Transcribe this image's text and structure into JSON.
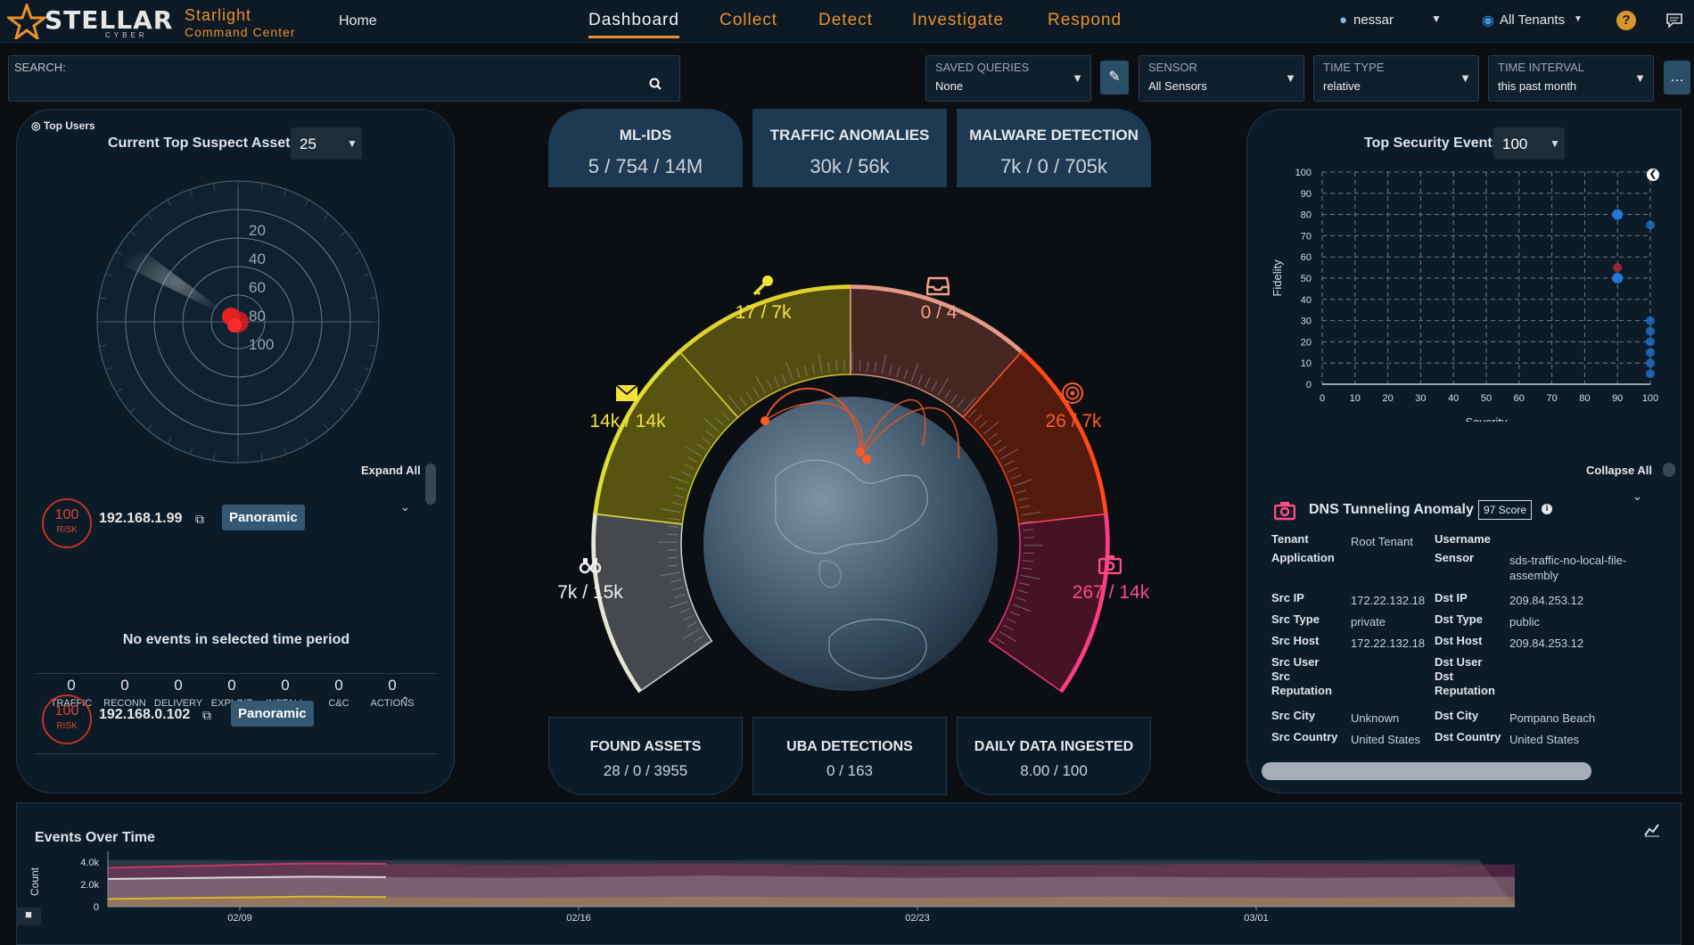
{
  "header": {
    "logo": "STELLAR",
    "logo_sub": "CYBER",
    "app_name": "Starlight",
    "app_sub": "Command Center",
    "home": "Home",
    "tabs": [
      "Dashboard",
      "Collect",
      "Detect",
      "Investigate",
      "Respond"
    ],
    "active_tab": "Dashboard",
    "user": "nessar",
    "tenant": "All Tenants"
  },
  "filters": {
    "search_label": "SEARCH:",
    "search_value": "",
    "saved_queries_label": "SAVED QUERIES",
    "saved_queries_value": "None",
    "sensor_label": "SENSOR",
    "sensor_value": "All Sensors",
    "time_type_label": "TIME TYPE",
    "time_type_value": "relative",
    "time_interval_label": "TIME INTERVAL",
    "time_interval_value": "this past month"
  },
  "left_panel": {
    "top_users": "Top Users",
    "title": "Current Top Suspect Assets",
    "count": "25",
    "radar_rings": [
      "20",
      "40",
      "60",
      "80",
      "100"
    ],
    "expand_all": "Expand All",
    "assets": [
      {
        "risk": "100",
        "risk_label": "RISK",
        "ip": "192.168.1.99",
        "button": "Panoramic"
      },
      {
        "risk": "100",
        "risk_label": "RISK",
        "ip": "192.168.0.102",
        "button": "Panoramic"
      }
    ],
    "killchain": [
      {
        "count": "0",
        "label": "TRAFFIC"
      },
      {
        "count": "0",
        "label": "RECONN"
      },
      {
        "count": "0",
        "label": "DELIVERY"
      },
      {
        "count": "0",
        "label": "EXPLOIT"
      },
      {
        "count": "0",
        "label": "INSTALL"
      },
      {
        "count": "0",
        "label": "C&C"
      },
      {
        "count": "0",
        "label": "ACTIONS"
      }
    ],
    "no_events": "No events in selected time period"
  },
  "center": {
    "top_cards": [
      {
        "title": "ML-IDS",
        "value": "5 / 754 / 14M"
      },
      {
        "title": "TRAFFIC ANOMALIES",
        "value": "30k / 56k"
      },
      {
        "title": "MALWARE DETECTION",
        "value": "7k / 0 / 705k"
      }
    ],
    "bottom_cards": [
      {
        "title": "FOUND ASSETS",
        "value": "28 / 0 / 3955"
      },
      {
        "title": "UBA DETECTIONS",
        "value": "0 / 163"
      },
      {
        "title": "DAILY DATA INGESTED",
        "value": "8.00 / 100"
      }
    ],
    "segments": [
      {
        "label": "7k / 15k",
        "icon": "binoculars-icon",
        "color": "#f0f0f0"
      },
      {
        "label": "14k / 14k",
        "icon": "envelope-icon",
        "color": "#f2e23a"
      },
      {
        "label": "17 / 7k",
        "icon": "key-icon",
        "color": "#f2e23a"
      },
      {
        "label": "0 / 4",
        "icon": "inbox-icon",
        "color": "#f3a08a"
      },
      {
        "label": "26 / 7k",
        "icon": "target-icon",
        "color": "#ff5a2a"
      },
      {
        "label": "267 / 14k",
        "icon": "camera-icon",
        "color": "#ff4d88"
      }
    ]
  },
  "right_panel": {
    "title": "Top Security Events",
    "count": "100",
    "x_label": "Severity",
    "y_label": "Fidelity",
    "collapse_all": "Collapse All",
    "event": {
      "title": "DNS Tunneling Anomaly",
      "score": "97 Score",
      "fields_left": [
        {
          "k": "Tenant",
          "v": "Root Tenant"
        },
        {
          "k": "Application",
          "v": ""
        },
        {
          "k": "Src IP",
          "v": "172.22.132.18"
        },
        {
          "k": "Src Type",
          "v": "private"
        },
        {
          "k": "Src Host",
          "v": "172.22.132.18"
        },
        {
          "k": "Src User",
          "v": ""
        },
        {
          "k": "Src Reputation",
          "v": ""
        },
        {
          "k": "Src City",
          "v": "Unknown"
        },
        {
          "k": "Src Country",
          "v": "United States"
        }
      ],
      "fields_right": [
        {
          "k": "Username",
          "v": ""
        },
        {
          "k": "Sensor",
          "v": "sds-traffic-no-local-file-assembly"
        },
        {
          "k": "Dst IP",
          "v": "209.84.253.12"
        },
        {
          "k": "Dst Type",
          "v": "public"
        },
        {
          "k": "Dst Host",
          "v": "209.84.253.12"
        },
        {
          "k": "Dst User",
          "v": ""
        },
        {
          "k": "Dst Reputation",
          "v": ""
        },
        {
          "k": "Dst City",
          "v": "Pompano Beach"
        },
        {
          "k": "Dst Country",
          "v": "United States"
        }
      ]
    }
  },
  "chart_data": [
    {
      "type": "scatter",
      "title": "Top Security Events",
      "xlabel": "Severity",
      "ylabel": "Fidelity",
      "xlim": [
        0,
        100
      ],
      "ylim": [
        0,
        100
      ],
      "xticks": [
        0,
        10,
        20,
        30,
        40,
        50,
        60,
        70,
        80,
        90,
        100
      ],
      "yticks": [
        0,
        10,
        20,
        30,
        40,
        50,
        60,
        70,
        80,
        90,
        100
      ],
      "grid": true,
      "points": [
        {
          "x": 90,
          "y": 80
        },
        {
          "x": 90,
          "y": 50
        },
        {
          "x": 90,
          "y": 55
        },
        {
          "x": 100,
          "y": 75
        },
        {
          "x": 100,
          "y": 30
        },
        {
          "x": 100,
          "y": 25
        },
        {
          "x": 100,
          "y": 20
        },
        {
          "x": 100,
          "y": 15
        },
        {
          "x": 100,
          "y": 10
        },
        {
          "x": 100,
          "y": 5
        }
      ]
    },
    {
      "type": "area",
      "title": "Events Over Time",
      "ylabel": "Count",
      "yticks": [
        "0",
        "2.0k",
        "4.0k"
      ],
      "xticks": [
        "02/09",
        "02/16",
        "02/23",
        "03/01"
      ],
      "series": [
        {
          "values": [
            3500,
            3900,
            3800,
            3900,
            3700,
            3800,
            3900,
            3800
          ]
        },
        {
          "values": [
            2500,
            2700,
            2600,
            2800,
            2600,
            2700,
            2600,
            2700
          ]
        },
        {
          "values": [
            700,
            900,
            800,
            900,
            800,
            900,
            800,
            900
          ]
        }
      ]
    }
  ],
  "bottom": {
    "title": "Events Over Time"
  }
}
